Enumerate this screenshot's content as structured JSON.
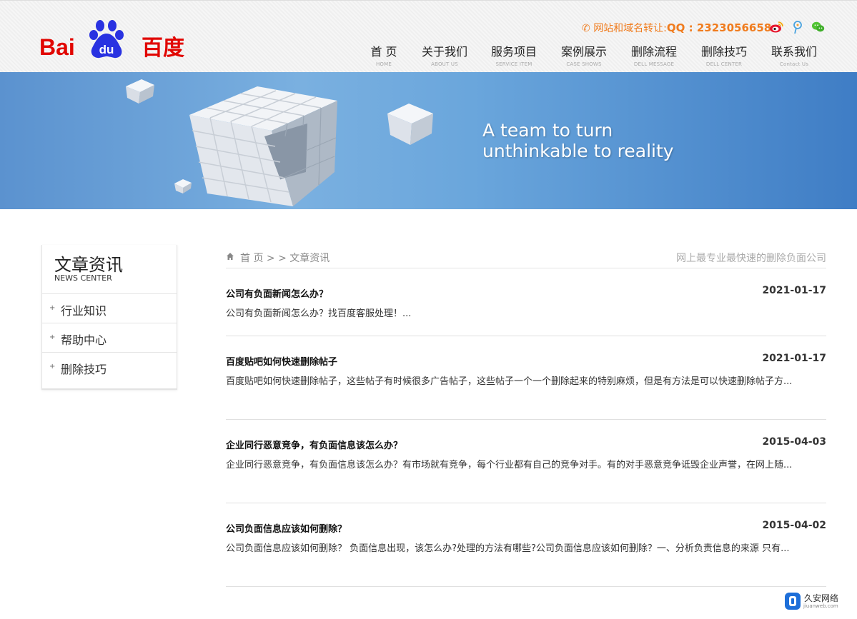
{
  "header": {
    "logo_text": "Bai du 百度",
    "contact_label": "网站和域名转让:",
    "contact_qq": "QQ : 2323056658",
    "nav": [
      {
        "cn": "首 页",
        "en": "HOME"
      },
      {
        "cn": "关于我们",
        "en": "ABOUT US"
      },
      {
        "cn": "服务项目",
        "en": "SERVICE ITEM"
      },
      {
        "cn": "案例展示",
        "en": "CASE SHOWS"
      },
      {
        "cn": "删除流程",
        "en": "DELL MESSAGE"
      },
      {
        "cn": "删除技巧",
        "en": "DELL CENTER"
      },
      {
        "cn": "联系我们",
        "en": "Contact Us"
      }
    ]
  },
  "banner": {
    "line1": "A team to turn",
    "line2": "unthinkable to reality"
  },
  "sidebar": {
    "title": "文章资讯",
    "subtitle": "NEWS CENTER",
    "items": [
      {
        "label": "行业知识"
      },
      {
        "label": "帮助中心"
      },
      {
        "label": "删除技巧"
      }
    ]
  },
  "breadcrumb": {
    "text": "首 页 > > 文章资讯",
    "slogan": "网上最专业最快速的删除负面公司"
  },
  "articles": [
    {
      "title": "公司有负面新闻怎么办？",
      "date": "2021-01-17",
      "summary": "公司有负面新闻怎么办？找百度客服处理！..."
    },
    {
      "title": "百度贴吧如何快速删除帖子",
      "date": "2021-01-17",
      "summary": "百度贴吧如何快速删除帖子，这些帖子有时候很多广告帖子，这些帖子一个一个删除起来的特别麻烦，但是有方法是可以快速删除帖子方..."
    },
    {
      "title": "企业同行恶意竞争，有负面信息该怎么办？",
      "date": "2015-04-03",
      "summary": "企业同行恶意竞争，有负面信息该怎么办？有市场就有竞争，每个行业都有自己的竞争对手。有的对手恶意竞争诋毁企业声誉，在网上随..."
    },
    {
      "title": "公司负面信息应该如何删除？",
      "date": "2015-04-02",
      "summary": "公司负面信息应该如何删除？ 负面信息出现，该怎么办?处理的方法有哪些?公司负面信息应该如何删除？一、分析负责信息的来源 只有..."
    }
  ],
  "watermark": {
    "name": "久安网络",
    "url": "jiuanweb.com"
  },
  "colors": {
    "brand_red": "#e10601",
    "brand_blue": "#2932e1",
    "contact_orange": "#f07c1e"
  }
}
